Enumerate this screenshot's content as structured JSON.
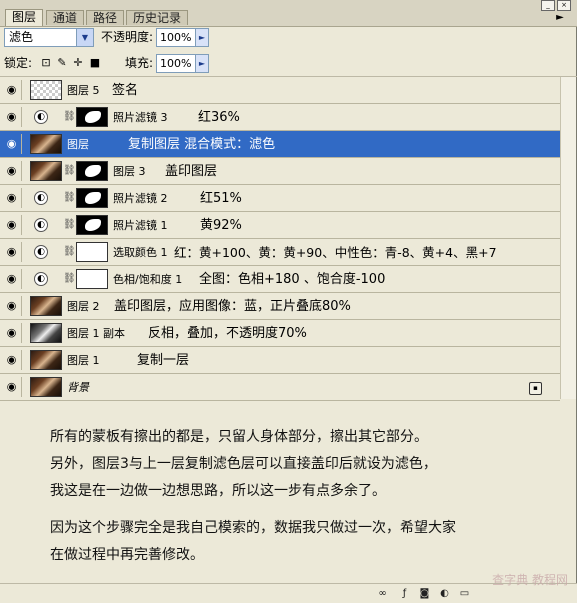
{
  "tabs": [
    "图层",
    "通道",
    "路径",
    "历史记录"
  ],
  "blend_mode": "滤色",
  "opacity_label": "不透明度:",
  "opacity_value": "100%",
  "lock_label": "锁定:",
  "fill_label": "填充:",
  "fill_value": "100%",
  "layers": [
    {
      "name": "图层 5",
      "note": "签名"
    },
    {
      "name": "照片滤镜 3",
      "note": "红36%"
    },
    {
      "name": "图层",
      "note": "复制图层  混合模式：滤色"
    },
    {
      "name": "图层 3",
      "note": "盖印图层"
    },
    {
      "name": "照片滤镜 2",
      "note": "红51%"
    },
    {
      "name": "照片滤镜 1",
      "note": "黄92%"
    },
    {
      "name": "选取颜色 1",
      "note": "红：黄+100、黄：黄+90、中性色：青-8、黄+4、黑+7"
    },
    {
      "name": "色相/饱和度 1",
      "note": "全图：色相+180  、饱合度-100"
    },
    {
      "name": "图层 2",
      "note": "盖印图层，应用图像：蓝，正片叠底80%"
    },
    {
      "name": "图层 1 副本",
      "note": "反相，叠加，不透明度70%"
    },
    {
      "name": "图层 1",
      "note": "复制一层"
    },
    {
      "name": "背景",
      "note": ""
    }
  ],
  "note_lines": [
    "所有的蒙板有擦出的都是，只留人身体部分，擦出其它部分。",
    "另外，图层3与上一层复制滤色层可以直接盖印后就设为滤色，",
    "我这是在一边做一边想思路，所以这一步有点多余了。",
    "因为这个步骤完全是我自己模索的，数据我只做过一次，希望大家",
    "在做过程中再完善修改。"
  ],
  "watermark": "查字典 教程网",
  "colors": {
    "selected": "#316ac5",
    "panel": "#ece9d8"
  }
}
